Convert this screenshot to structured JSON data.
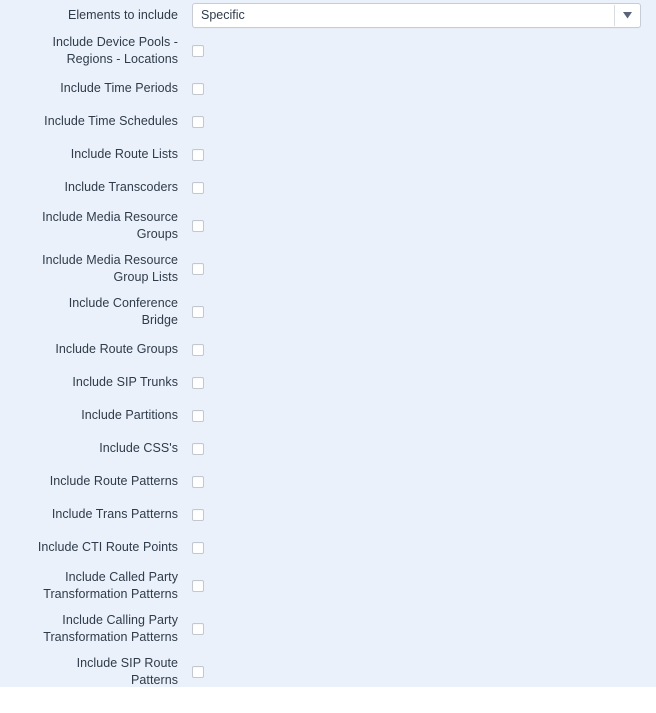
{
  "panel": {
    "background_color": "#eaf1fa",
    "label_color": "#2f3b4a"
  },
  "select_row": {
    "label": "Elements to include",
    "value": "Specific",
    "arrow_icon": "chevron-down-icon",
    "arrow_color": "#5a6479",
    "options": [
      "Specific"
    ]
  },
  "checkbox_rows": [
    {
      "label_lines": [
        "Include Device Pools -",
        "Regions - Locations"
      ],
      "checked": false
    },
    {
      "label_lines": [
        "Include Time Periods"
      ],
      "checked": false
    },
    {
      "label_lines": [
        "Include Time Schedules"
      ],
      "checked": false
    },
    {
      "label_lines": [
        "Include Route Lists"
      ],
      "checked": false
    },
    {
      "label_lines": [
        "Include Transcoders"
      ],
      "checked": false
    },
    {
      "label_lines": [
        "Include Media Resource",
        "Groups"
      ],
      "checked": false
    },
    {
      "label_lines": [
        "Include Media Resource",
        "Group Lists"
      ],
      "checked": false
    },
    {
      "label_lines": [
        "Include Conference",
        "Bridge"
      ],
      "checked": false
    },
    {
      "label_lines": [
        "Include Route Groups"
      ],
      "checked": false
    },
    {
      "label_lines": [
        "Include SIP Trunks"
      ],
      "checked": false
    },
    {
      "label_lines": [
        "Include Partitions"
      ],
      "checked": false
    },
    {
      "label_lines": [
        "Include CSS's"
      ],
      "checked": false
    },
    {
      "label_lines": [
        "Include Route Patterns"
      ],
      "checked": false
    },
    {
      "label_lines": [
        "Include Trans Patterns"
      ],
      "checked": false
    },
    {
      "label_lines": [
        "Include CTI Route Points"
      ],
      "checked": false
    },
    {
      "label_lines": [
        "Include Called Party",
        "Transformation Patterns"
      ],
      "checked": false
    },
    {
      "label_lines": [
        "Include Calling Party",
        "Transformation Patterns"
      ],
      "checked": false
    },
    {
      "label_lines": [
        "Include SIP Route",
        "Patterns"
      ],
      "checked": false
    }
  ]
}
